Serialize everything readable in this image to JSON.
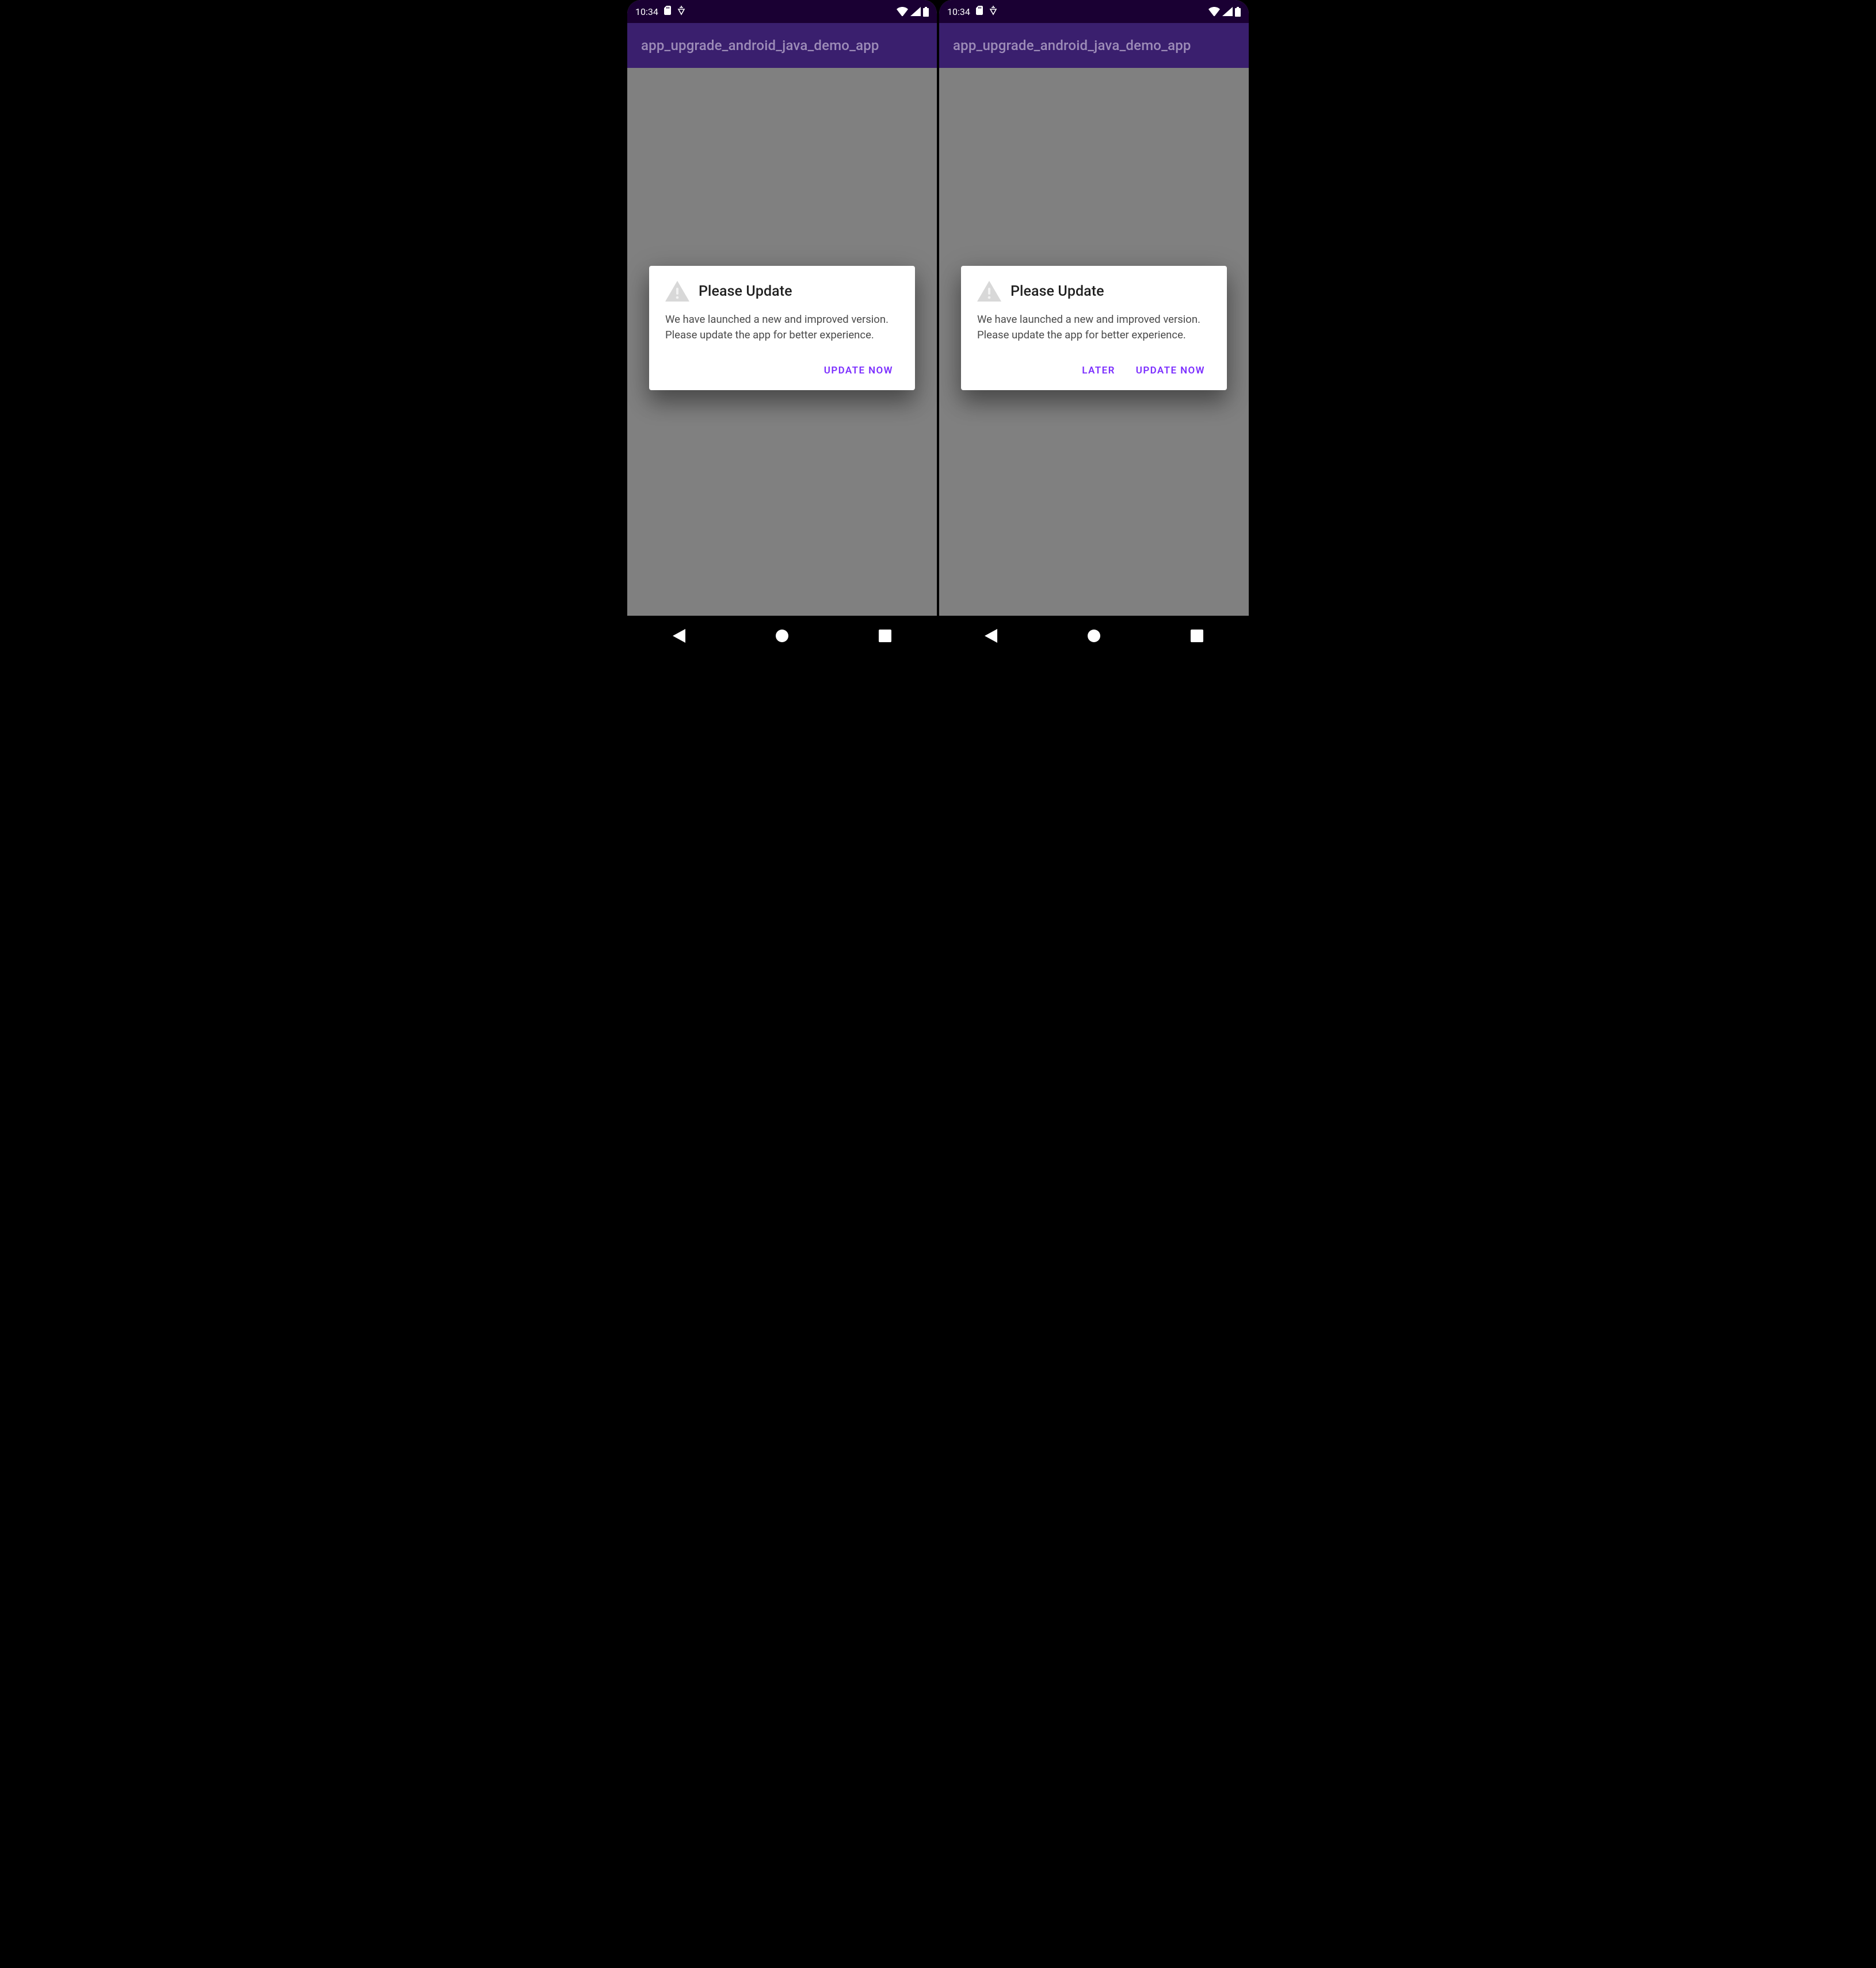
{
  "status": {
    "time": "10:34"
  },
  "appbar": {
    "title": "app_upgrade_android_java_demo_app"
  },
  "dialogs": {
    "left": {
      "title": "Please Update",
      "message": "We have launched a new and improved version. Please update the app for better experience.",
      "primary": "Update Now"
    },
    "right": {
      "title": "Please Update",
      "message": "We have launched a new and improved version. Please update the app for better experience.",
      "secondary": "Later",
      "primary": "Update Now"
    }
  },
  "colors": {
    "accent": "#7c2fff",
    "appbar": "#3a1f6e",
    "statusbar": "#1a0033"
  }
}
